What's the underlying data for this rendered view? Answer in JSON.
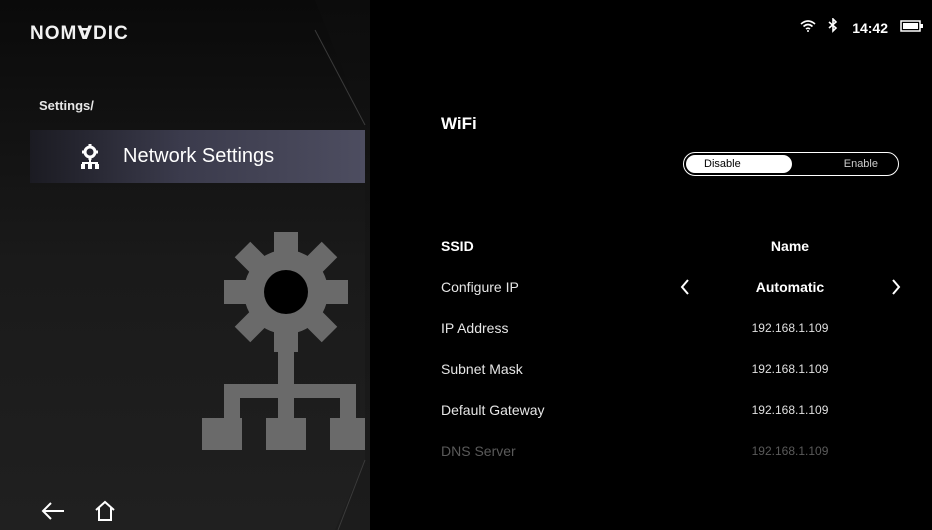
{
  "brand": {
    "logo_text": "NOMⱯDIC"
  },
  "status_bar": {
    "time": "14:42",
    "icons": [
      "wifi-icon",
      "bluetooth-icon",
      "battery-icon"
    ]
  },
  "breadcrumb": "Settings/",
  "nav": {
    "active_item_label": "Network Settings",
    "active_item_icon": "network-icon"
  },
  "wifi": {
    "title": "WiFi",
    "toggle_options": [
      "Disable",
      "Enable"
    ],
    "selected_option": "Disable"
  },
  "settings_rows": [
    {
      "label": "SSID",
      "value": "Name"
    },
    {
      "label": "Configure IP",
      "value": "Automatic"
    },
    {
      "label": "IP Address",
      "value": "192.168.1.109"
    },
    {
      "label": "Subnet Mask",
      "value": "192.168.1.109"
    },
    {
      "label": "Default Gateway",
      "value": "192.168.1.109"
    },
    {
      "label": "DNS Server",
      "value": "192.168.1.109"
    }
  ],
  "bottom_nav": {
    "icons": [
      "back-arrow-icon",
      "home-icon"
    ]
  },
  "colors": {
    "background": "#000000",
    "highlight": "#4d4d60",
    "text": "#ffffff"
  }
}
